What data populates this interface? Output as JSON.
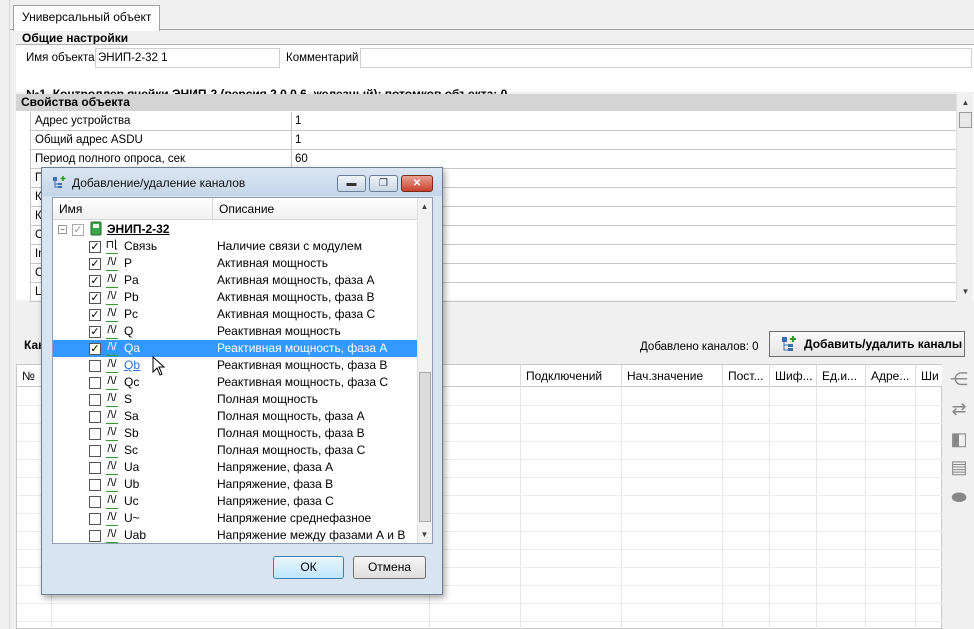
{
  "tab": {
    "label": "Универсальный объект"
  },
  "general": {
    "title": "Общие настройки",
    "name_label": "Имя объекта",
    "name_value": "ЭНИП-2-32 1",
    "comment_label": "Комментарий",
    "comment_value": "",
    "summary": "№1. Контроллер ячейки ЭНИП-2 (версия 2.0.0.6, железный); потомков объекта: 0"
  },
  "properties": {
    "title": "Свойства объекта",
    "rows": [
      {
        "name": "Адрес устройства",
        "value": "1"
      },
      {
        "name": "Общий адрес ASDU",
        "value": "1"
      },
      {
        "name": "Период полного опроса, сек",
        "value": "60"
      },
      {
        "name": "П",
        "value": ""
      },
      {
        "name": "К",
        "value": ""
      },
      {
        "name": "К",
        "value": ""
      },
      {
        "name": "С",
        "value": ""
      },
      {
        "name": "In",
        "value": ""
      },
      {
        "name": "С",
        "value": ""
      },
      {
        "name": "Lu",
        "value": ""
      }
    ]
  },
  "channels": {
    "title": "Кан",
    "added_label": "Добавлено каналов: 0",
    "add_remove_label": "Добавить/удалить каналы",
    "columns": [
      "№",
      "Подключений",
      "Нач.значение",
      "Пост...",
      "Шиф...",
      "Ед.и...",
      "Адре...",
      "Ши"
    ]
  },
  "dialog": {
    "title": "Добавление/удаление каналов",
    "col_name": "Имя",
    "col_desc": "Описание",
    "root": "ЭНИП-2-32",
    "items": [
      {
        "name": "Связь",
        "desc": "Наличие связи с модулем",
        "checked": true,
        "icon": "link-signal"
      },
      {
        "name": "P",
        "desc": "Активная мощность",
        "checked": true,
        "icon": "analog-signal"
      },
      {
        "name": "Pa",
        "desc": "Активная мощность, фаза А",
        "checked": true,
        "icon": "analog-signal"
      },
      {
        "name": "Pb",
        "desc": "Активная мощность, фаза В",
        "checked": true,
        "icon": "analog-signal"
      },
      {
        "name": "Pc",
        "desc": "Активная мощность, фаза С",
        "checked": true,
        "icon": "analog-signal"
      },
      {
        "name": "Q",
        "desc": "Реактивная мощность",
        "checked": true,
        "icon": "analog-signal"
      },
      {
        "name": "Qa",
        "desc": "Реактивная мощность, фаза А",
        "checked": true,
        "icon": "analog-signal",
        "selected": true
      },
      {
        "name": "Qb",
        "desc": "Реактивная мощность, фаза В",
        "checked": false,
        "icon": "analog-signal",
        "hover": true
      },
      {
        "name": "Qc",
        "desc": "Реактивная мощность, фаза С",
        "checked": false,
        "icon": "analog-signal"
      },
      {
        "name": "S",
        "desc": "Полная мощность",
        "checked": false,
        "icon": "analog-signal"
      },
      {
        "name": "Sa",
        "desc": "Полная мощность, фаза А",
        "checked": false,
        "icon": "analog-signal"
      },
      {
        "name": "Sb",
        "desc": "Полная мощность, фаза В",
        "checked": false,
        "icon": "analog-signal"
      },
      {
        "name": "Sc",
        "desc": "Полная мощность, фаза С",
        "checked": false,
        "icon": "analog-signal"
      },
      {
        "name": "Ua",
        "desc": "Напряжение, фаза А",
        "checked": false,
        "icon": "analog-signal"
      },
      {
        "name": "Ub",
        "desc": "Напряжение, фаза В",
        "checked": false,
        "icon": "analog-signal"
      },
      {
        "name": "Uc",
        "desc": "Напряжение, фаза С",
        "checked": false,
        "icon": "analog-signal"
      },
      {
        "name": "U~",
        "desc": "Напряжение среднефазное",
        "checked": false,
        "icon": "analog-signal"
      },
      {
        "name": "Uab",
        "desc": "Напряжение между фазами А и В",
        "checked": false,
        "icon": "analog-signal"
      }
    ],
    "ok_label": "ОК",
    "cancel_label": "Отмена",
    "colors": {
      "selection": "#3399ff",
      "link": "#2a6fdb",
      "signal_green": "#2f9e2f"
    }
  }
}
